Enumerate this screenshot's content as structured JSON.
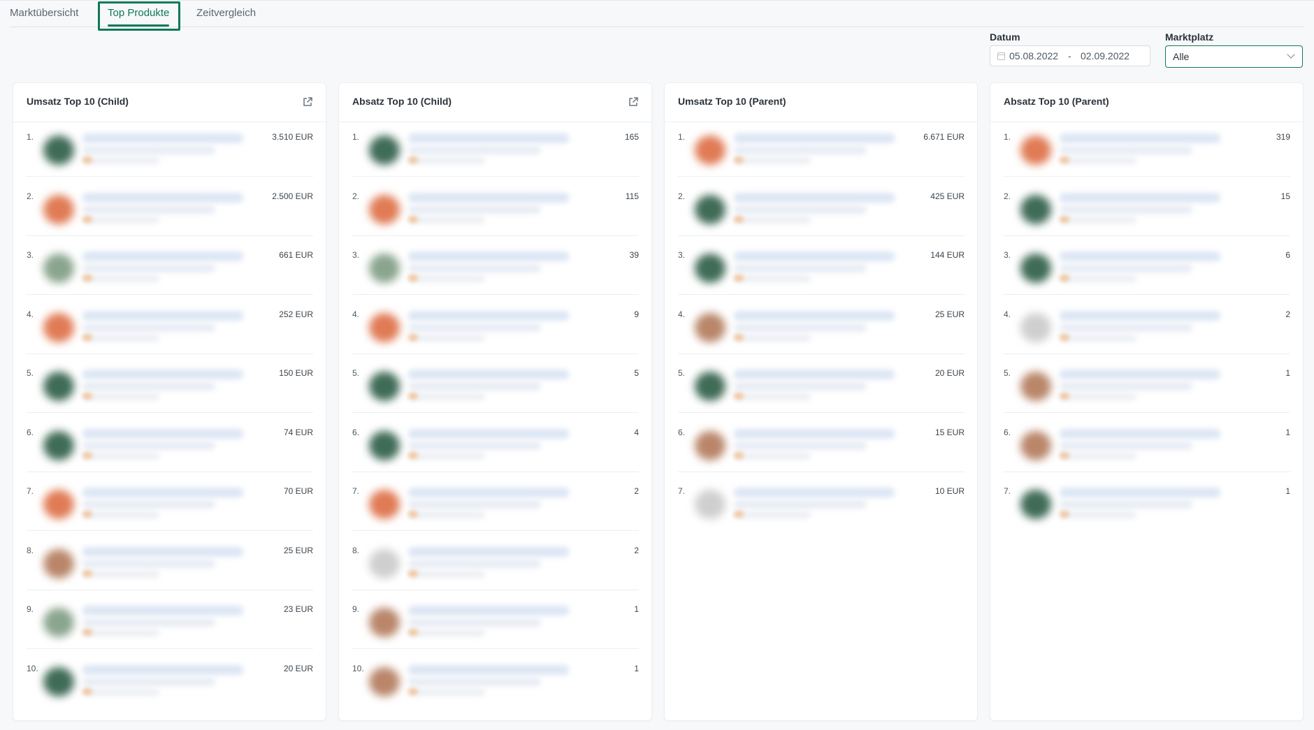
{
  "tabs": [
    {
      "label": "Marktübersicht"
    },
    {
      "label": "Top Produkte",
      "active": true
    },
    {
      "label": "Zeitvergleich"
    }
  ],
  "filters": {
    "date_label": "Datum",
    "date_from": "05.08.2022",
    "date_sep": "-",
    "date_to": "02.09.2022",
    "marketplace_label": "Marktplatz",
    "marketplace_value": "Alle"
  },
  "colors": {
    "accent": "#0d7a55",
    "thumb_green": "#3f6b57",
    "thumb_orange": "#e07b55",
    "thumb_sage": "#8aa58e",
    "thumb_brown": "#b9866a",
    "thumb_grey": "#cfcfcf"
  },
  "cards": [
    {
      "title": "Umsatz Top 10 (Child)",
      "has_export": true,
      "items": [
        {
          "rank": "1.",
          "value": "3.510 EUR",
          "thumb": "green"
        },
        {
          "rank": "2.",
          "value": "2.500 EUR",
          "thumb": "orange"
        },
        {
          "rank": "3.",
          "value": "661 EUR",
          "thumb": "sage"
        },
        {
          "rank": "4.",
          "value": "252 EUR",
          "thumb": "orange"
        },
        {
          "rank": "5.",
          "value": "150 EUR",
          "thumb": "green"
        },
        {
          "rank": "6.",
          "value": "74 EUR",
          "thumb": "green"
        },
        {
          "rank": "7.",
          "value": "70 EUR",
          "thumb": "orange"
        },
        {
          "rank": "8.",
          "value": "25 EUR",
          "thumb": "brown"
        },
        {
          "rank": "9.",
          "value": "23 EUR",
          "thumb": "sage"
        },
        {
          "rank": "10.",
          "value": "20 EUR",
          "thumb": "green"
        }
      ]
    },
    {
      "title": "Absatz Top 10 (Child)",
      "has_export": true,
      "items": [
        {
          "rank": "1.",
          "value": "165",
          "thumb": "green"
        },
        {
          "rank": "2.",
          "value": "115",
          "thumb": "orange"
        },
        {
          "rank": "3.",
          "value": "39",
          "thumb": "sage"
        },
        {
          "rank": "4.",
          "value": "9",
          "thumb": "orange"
        },
        {
          "rank": "5.",
          "value": "5",
          "thumb": "green"
        },
        {
          "rank": "6.",
          "value": "4",
          "thumb": "green"
        },
        {
          "rank": "7.",
          "value": "2",
          "thumb": "orange"
        },
        {
          "rank": "8.",
          "value": "2",
          "thumb": "grey"
        },
        {
          "rank": "9.",
          "value": "1",
          "thumb": "brown"
        },
        {
          "rank": "10.",
          "value": "1",
          "thumb": "brown"
        }
      ]
    },
    {
      "title": "Umsatz Top 10 (Parent)",
      "has_export": false,
      "items": [
        {
          "rank": "1.",
          "value": "6.671 EUR",
          "thumb": "orange"
        },
        {
          "rank": "2.",
          "value": "425 EUR",
          "thumb": "green"
        },
        {
          "rank": "3.",
          "value": "144 EUR",
          "thumb": "green"
        },
        {
          "rank": "4.",
          "value": "25 EUR",
          "thumb": "brown"
        },
        {
          "rank": "5.",
          "value": "20 EUR",
          "thumb": "green"
        },
        {
          "rank": "6.",
          "value": "15 EUR",
          "thumb": "brown"
        },
        {
          "rank": "7.",
          "value": "10 EUR",
          "thumb": "grey"
        }
      ]
    },
    {
      "title": "Absatz Top 10 (Parent)",
      "has_export": false,
      "items": [
        {
          "rank": "1.",
          "value": "319",
          "thumb": "orange"
        },
        {
          "rank": "2.",
          "value": "15",
          "thumb": "green"
        },
        {
          "rank": "3.",
          "value": "6",
          "thumb": "green"
        },
        {
          "rank": "4.",
          "value": "2",
          "thumb": "grey"
        },
        {
          "rank": "5.",
          "value": "1",
          "thumb": "brown"
        },
        {
          "rank": "6.",
          "value": "1",
          "thumb": "brown"
        },
        {
          "rank": "7.",
          "value": "1",
          "thumb": "green"
        }
      ]
    }
  ]
}
